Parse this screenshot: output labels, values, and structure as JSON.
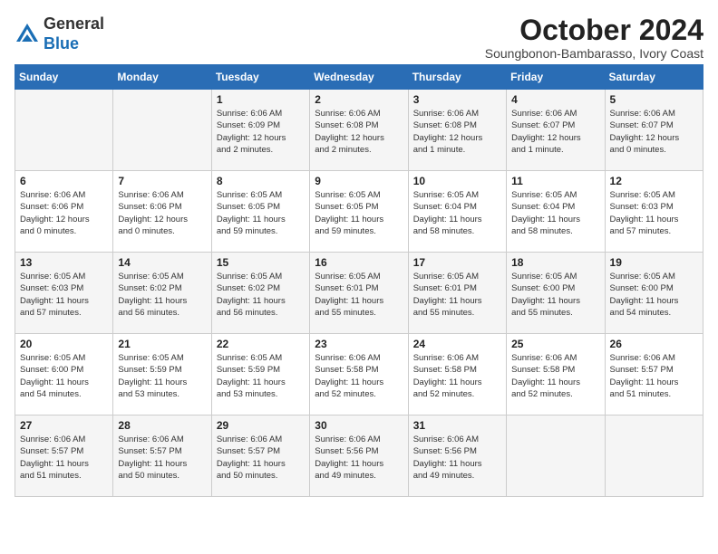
{
  "header": {
    "logo_general": "General",
    "logo_blue": "Blue",
    "month_title": "October 2024",
    "location": "Soungbonon-Bambarasso, Ivory Coast"
  },
  "weekdays": [
    "Sunday",
    "Monday",
    "Tuesday",
    "Wednesday",
    "Thursday",
    "Friday",
    "Saturday"
  ],
  "weeks": [
    [
      {
        "day": "",
        "detail": ""
      },
      {
        "day": "",
        "detail": ""
      },
      {
        "day": "1",
        "detail": "Sunrise: 6:06 AM\nSunset: 6:09 PM\nDaylight: 12 hours\nand 2 minutes."
      },
      {
        "day": "2",
        "detail": "Sunrise: 6:06 AM\nSunset: 6:08 PM\nDaylight: 12 hours\nand 2 minutes."
      },
      {
        "day": "3",
        "detail": "Sunrise: 6:06 AM\nSunset: 6:08 PM\nDaylight: 12 hours\nand 1 minute."
      },
      {
        "day": "4",
        "detail": "Sunrise: 6:06 AM\nSunset: 6:07 PM\nDaylight: 12 hours\nand 1 minute."
      },
      {
        "day": "5",
        "detail": "Sunrise: 6:06 AM\nSunset: 6:07 PM\nDaylight: 12 hours\nand 0 minutes."
      }
    ],
    [
      {
        "day": "6",
        "detail": "Sunrise: 6:06 AM\nSunset: 6:06 PM\nDaylight: 12 hours\nand 0 minutes."
      },
      {
        "day": "7",
        "detail": "Sunrise: 6:06 AM\nSunset: 6:06 PM\nDaylight: 12 hours\nand 0 minutes."
      },
      {
        "day": "8",
        "detail": "Sunrise: 6:05 AM\nSunset: 6:05 PM\nDaylight: 11 hours\nand 59 minutes."
      },
      {
        "day": "9",
        "detail": "Sunrise: 6:05 AM\nSunset: 6:05 PM\nDaylight: 11 hours\nand 59 minutes."
      },
      {
        "day": "10",
        "detail": "Sunrise: 6:05 AM\nSunset: 6:04 PM\nDaylight: 11 hours\nand 58 minutes."
      },
      {
        "day": "11",
        "detail": "Sunrise: 6:05 AM\nSunset: 6:04 PM\nDaylight: 11 hours\nand 58 minutes."
      },
      {
        "day": "12",
        "detail": "Sunrise: 6:05 AM\nSunset: 6:03 PM\nDaylight: 11 hours\nand 57 minutes."
      }
    ],
    [
      {
        "day": "13",
        "detail": "Sunrise: 6:05 AM\nSunset: 6:03 PM\nDaylight: 11 hours\nand 57 minutes."
      },
      {
        "day": "14",
        "detail": "Sunrise: 6:05 AM\nSunset: 6:02 PM\nDaylight: 11 hours\nand 56 minutes."
      },
      {
        "day": "15",
        "detail": "Sunrise: 6:05 AM\nSunset: 6:02 PM\nDaylight: 11 hours\nand 56 minutes."
      },
      {
        "day": "16",
        "detail": "Sunrise: 6:05 AM\nSunset: 6:01 PM\nDaylight: 11 hours\nand 55 minutes."
      },
      {
        "day": "17",
        "detail": "Sunrise: 6:05 AM\nSunset: 6:01 PM\nDaylight: 11 hours\nand 55 minutes."
      },
      {
        "day": "18",
        "detail": "Sunrise: 6:05 AM\nSunset: 6:00 PM\nDaylight: 11 hours\nand 55 minutes."
      },
      {
        "day": "19",
        "detail": "Sunrise: 6:05 AM\nSunset: 6:00 PM\nDaylight: 11 hours\nand 54 minutes."
      }
    ],
    [
      {
        "day": "20",
        "detail": "Sunrise: 6:05 AM\nSunset: 6:00 PM\nDaylight: 11 hours\nand 54 minutes."
      },
      {
        "day": "21",
        "detail": "Sunrise: 6:05 AM\nSunset: 5:59 PM\nDaylight: 11 hours\nand 53 minutes."
      },
      {
        "day": "22",
        "detail": "Sunrise: 6:05 AM\nSunset: 5:59 PM\nDaylight: 11 hours\nand 53 minutes."
      },
      {
        "day": "23",
        "detail": "Sunrise: 6:06 AM\nSunset: 5:58 PM\nDaylight: 11 hours\nand 52 minutes."
      },
      {
        "day": "24",
        "detail": "Sunrise: 6:06 AM\nSunset: 5:58 PM\nDaylight: 11 hours\nand 52 minutes."
      },
      {
        "day": "25",
        "detail": "Sunrise: 6:06 AM\nSunset: 5:58 PM\nDaylight: 11 hours\nand 52 minutes."
      },
      {
        "day": "26",
        "detail": "Sunrise: 6:06 AM\nSunset: 5:57 PM\nDaylight: 11 hours\nand 51 minutes."
      }
    ],
    [
      {
        "day": "27",
        "detail": "Sunrise: 6:06 AM\nSunset: 5:57 PM\nDaylight: 11 hours\nand 51 minutes."
      },
      {
        "day": "28",
        "detail": "Sunrise: 6:06 AM\nSunset: 5:57 PM\nDaylight: 11 hours\nand 50 minutes."
      },
      {
        "day": "29",
        "detail": "Sunrise: 6:06 AM\nSunset: 5:57 PM\nDaylight: 11 hours\nand 50 minutes."
      },
      {
        "day": "30",
        "detail": "Sunrise: 6:06 AM\nSunset: 5:56 PM\nDaylight: 11 hours\nand 49 minutes."
      },
      {
        "day": "31",
        "detail": "Sunrise: 6:06 AM\nSunset: 5:56 PM\nDaylight: 11 hours\nand 49 minutes."
      },
      {
        "day": "",
        "detail": ""
      },
      {
        "day": "",
        "detail": ""
      }
    ]
  ]
}
